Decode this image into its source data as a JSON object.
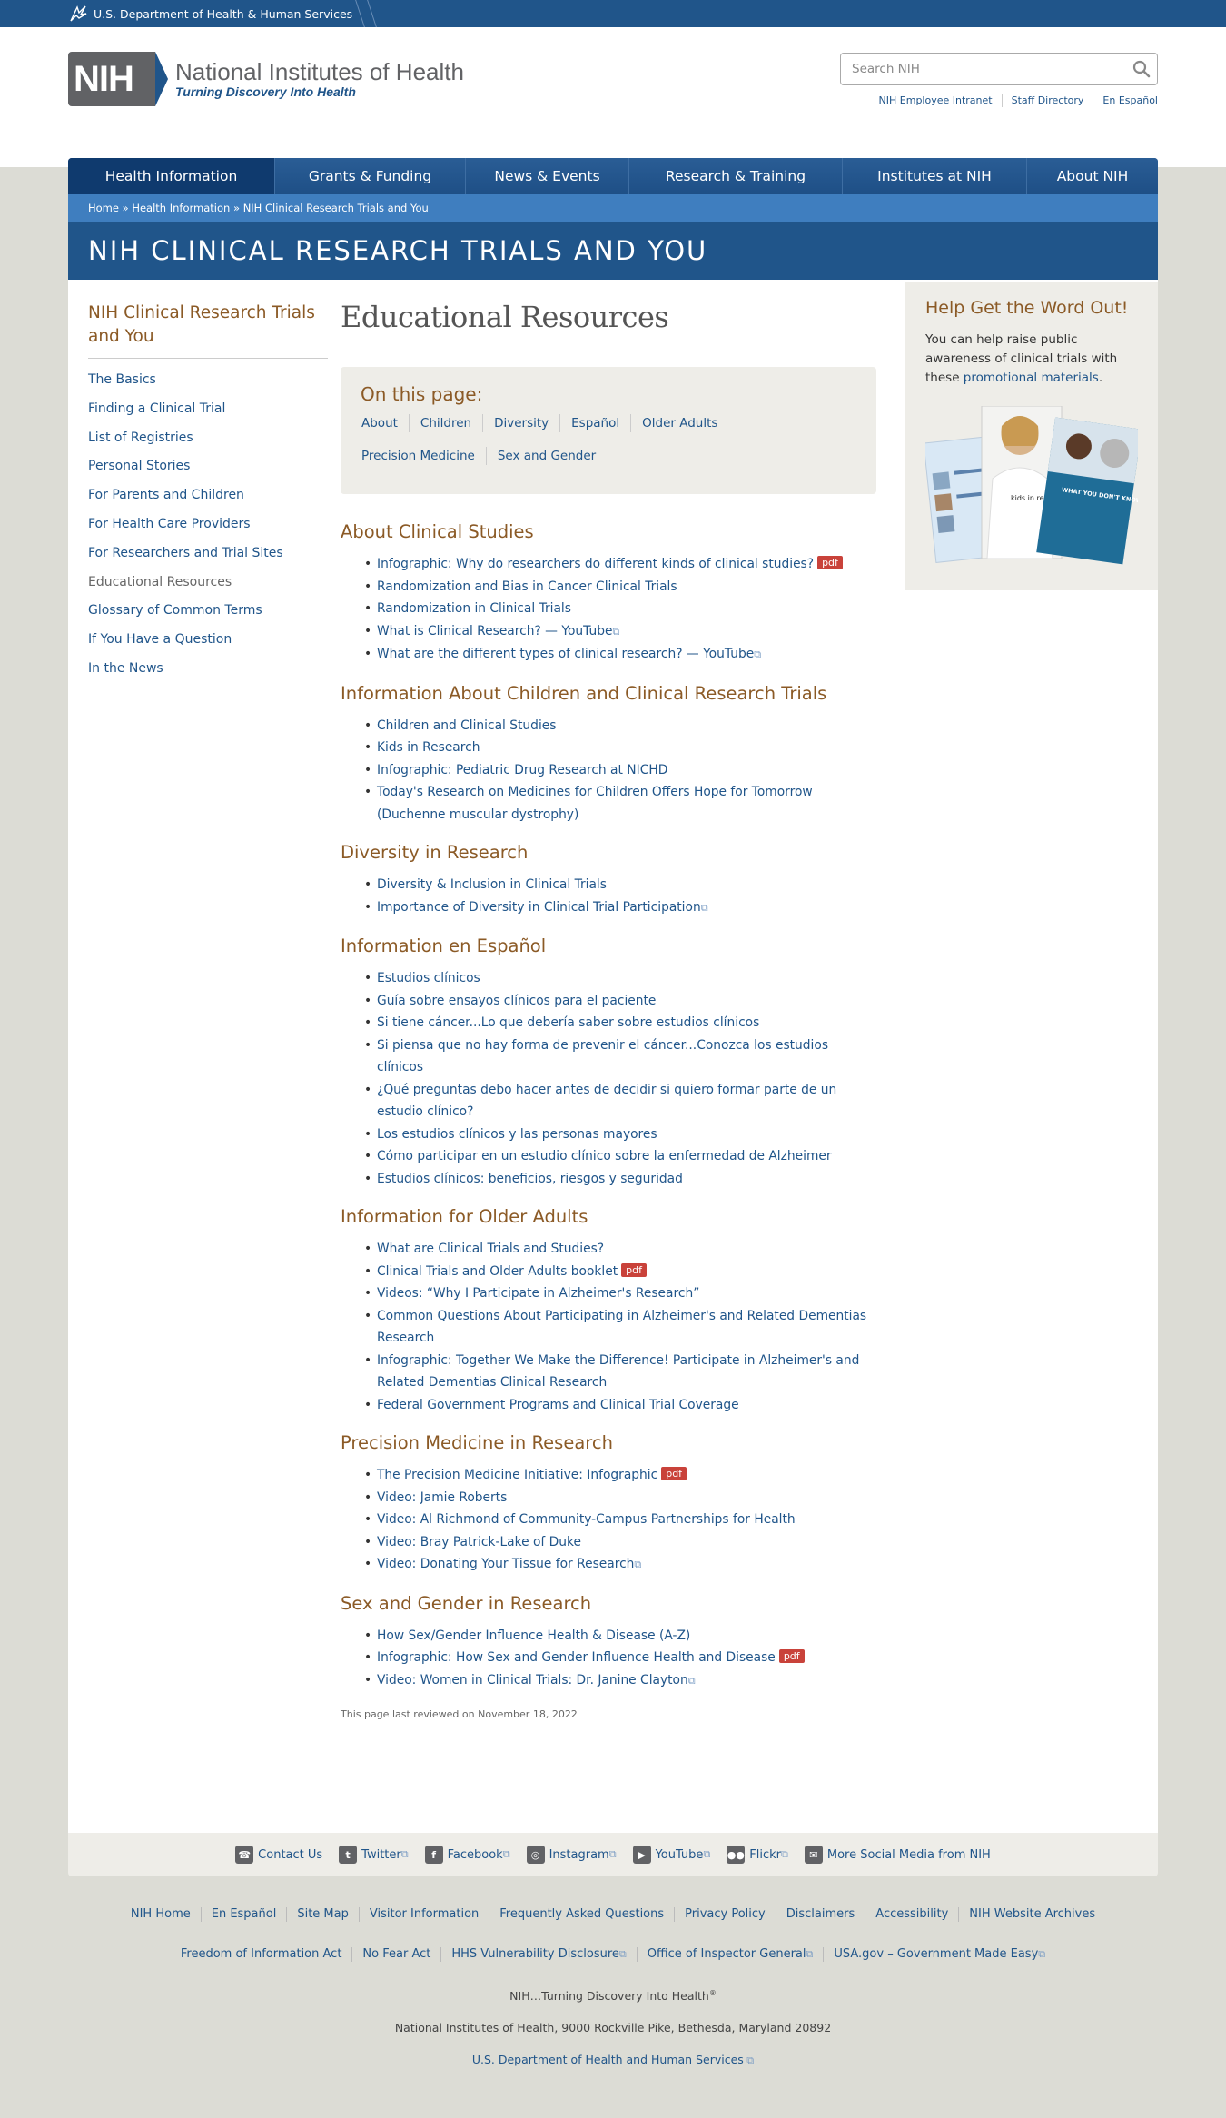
{
  "hhs": {
    "label": "U.S. Department of Health & Human Services"
  },
  "logo": {
    "mark": "NIH",
    "title": "National Institutes of Health",
    "tagline": "Turning Discovery Into Health"
  },
  "search": {
    "placeholder": "Search NIH"
  },
  "util_links": [
    "NIH Employee Intranet",
    "Staff Directory",
    "En Español"
  ],
  "nav": [
    "Health Information",
    "Grants & Funding",
    "News & Events",
    "Research & Training",
    "Institutes at NIH",
    "About NIH"
  ],
  "breadcrumb": {
    "home": "Home",
    "health": "Health Information",
    "current": "NIH Clinical Research Trials and You",
    "sep": "»"
  },
  "banner": {
    "title": "NIH CLINICAL RESEARCH TRIALS AND YOU"
  },
  "sidebar": {
    "title": "NIH Clinical Research Trials and You",
    "items": [
      "The Basics",
      "Finding a Clinical Trial",
      "List of Registries",
      "Personal Stories",
      "For Parents and Children",
      "For Health Care Providers",
      "For Researchers and Trial Sites",
      "Educational Resources",
      "Glossary of Common Terms",
      "If You Have a Question",
      "In the News"
    ]
  },
  "main": {
    "title": "Educational Resources",
    "onpage_title": "On this page:",
    "onpage_links": [
      "About",
      "Children",
      "Diversity",
      "Español",
      "Older Adults",
      "Precision Medicine",
      "Sex and Gender"
    ],
    "pdf_label": "pdf",
    "sections": [
      {
        "title": "About Clinical Studies",
        "items": [
          {
            "text": "Infographic: Why do researchers do different kinds of clinical studies?",
            "pdf": true
          },
          {
            "text": "Randomization and Bias in Cancer Clinical Trials"
          },
          {
            "text": "Randomization in Clinical Trials"
          },
          {
            "text": "What is Clinical Research? — YouTube",
            "ext": true
          },
          {
            "text": "What are the different types of clinical research? — YouTube",
            "ext": true
          }
        ]
      },
      {
        "title": "Information About Children and Clinical Research Trials",
        "items": [
          {
            "text": "Children and Clinical Studies"
          },
          {
            "text": "Kids in Research"
          },
          {
            "text": "Infographic: Pediatric Drug Research at NICHD"
          },
          {
            "text": "Today's Research on Medicines for Children Offers Hope for Tomorrow (Duchenne muscular dystrophy)"
          }
        ]
      },
      {
        "title": "Diversity in Research",
        "items": [
          {
            "text": "Diversity & Inclusion in Clinical Trials"
          },
          {
            "text": "Importance of Diversity in Clinical Trial Participation",
            "ext": true
          }
        ]
      },
      {
        "title": "Information en Español",
        "items": [
          {
            "text": "Estudios clínicos"
          },
          {
            "text": "Guía sobre ensayos clínicos para el paciente"
          },
          {
            "text": "Si tiene cáncer...Lo que debería saber sobre estudios clínicos"
          },
          {
            "text": "Si piensa que no hay forma de prevenir el cáncer...Conozca los estudios clínicos"
          },
          {
            "text": "¿Qué preguntas debo hacer antes de decidir si quiero formar parte de un estudio clínico?"
          },
          {
            "text": "Los estudios clínicos y las personas mayores"
          },
          {
            "text": "Cómo participar en un estudio clínico sobre la enfermedad de Alzheimer"
          },
          {
            "text": "Estudios clínicos: beneficios, riesgos y seguridad"
          }
        ]
      },
      {
        "title": "Information for Older Adults",
        "items": [
          {
            "text": "What are Clinical Trials and Studies?"
          },
          {
            "text": "Clinical Trials and Older Adults booklet",
            "pdf": true
          },
          {
            "text": "Videos: “Why I Participate in Alzheimer's Research”"
          },
          {
            "text": "Common Questions About Participating in Alzheimer's and Related Dementias Research"
          },
          {
            "text": "Infographic: Together We Make the Difference! Participate in Alzheimer's and Related Dementias Clinical Research"
          },
          {
            "text": "Federal Government Programs and Clinical Trial Coverage"
          }
        ]
      },
      {
        "title": "Precision Medicine in Research",
        "items": [
          {
            "text": "The Precision Medicine Initiative: Infographic",
            "pdf": true
          },
          {
            "text": "Video: Jamie Roberts"
          },
          {
            "text": "Video: Al Richmond of Community-Campus Partnerships for Health"
          },
          {
            "text": "Video: Bray Patrick-Lake of Duke"
          },
          {
            "text": "Video: Donating Your Tissue for Research",
            "ext": true
          }
        ]
      },
      {
        "title": "Sex and Gender in Research",
        "items": [
          {
            "text": "How Sex/Gender Influence Health & Disease (A-Z)"
          },
          {
            "text": "Infographic: How Sex and Gender Influence Health and Disease",
            "pdf": true
          },
          {
            "text": "Video: Women in Clinical Trials: Dr. Janine Clayton",
            "ext": true
          }
        ]
      }
    ],
    "reviewed": "This page last reviewed on November 18, 2022"
  },
  "aside": {
    "title": "Help Get the Word Out!",
    "text": "You can help raise public awareness of clinical trials with these",
    "link": "promotional materials",
    "link_suffix": ".",
    "poster_text": "WHAT YOU DON'T KNOW COULD HELP YOU.",
    "poster_shirt": "kids in research"
  },
  "social": [
    {
      "label": "Contact Us",
      "icon": "phone-icon",
      "ext": false
    },
    {
      "label": "Twitter",
      "icon": "twitter-icon",
      "ext": true
    },
    {
      "label": "Facebook",
      "icon": "facebook-icon",
      "ext": true
    },
    {
      "label": "Instagram",
      "icon": "instagram-icon",
      "ext": true
    },
    {
      "label": "YouTube",
      "icon": "youtube-icon",
      "ext": true
    },
    {
      "label": "Flickr",
      "icon": "flickr-icon",
      "ext": true
    },
    {
      "label": "More Social Media from NIH",
      "icon": "chat-icon",
      "ext": false
    }
  ],
  "footer": {
    "row1": [
      "NIH Home",
      "En Español",
      "Site Map",
      "Visitor Information",
      "Frequently Asked Questions",
      "Privacy Policy",
      "Disclaimers",
      "Accessibility",
      "NIH Website Archives"
    ],
    "row2": [
      {
        "label": "Freedom of Information Act",
        "ext": false
      },
      {
        "label": "No Fear Act",
        "ext": false
      },
      {
        "label": "HHS Vulnerability Disclosure",
        "ext": true
      },
      {
        "label": "Office of Inspector General",
        "ext": true
      },
      {
        "label": "USA.gov – Government Made Easy",
        "ext": true
      }
    ],
    "tagline": "NIH…Turning Discovery Into Health",
    "tagline_mark": "®",
    "address": "National Institutes of Health, 9000 Rockville Pike, Bethesda, Maryland 20892",
    "hhs": "U.S. Department of Health and Human Services"
  },
  "colors": {
    "primary": "#20558a",
    "accent": "#8b5a26",
    "pdf": "#c9423a",
    "panel": "#eeede8",
    "background": "#dcdcd5"
  }
}
